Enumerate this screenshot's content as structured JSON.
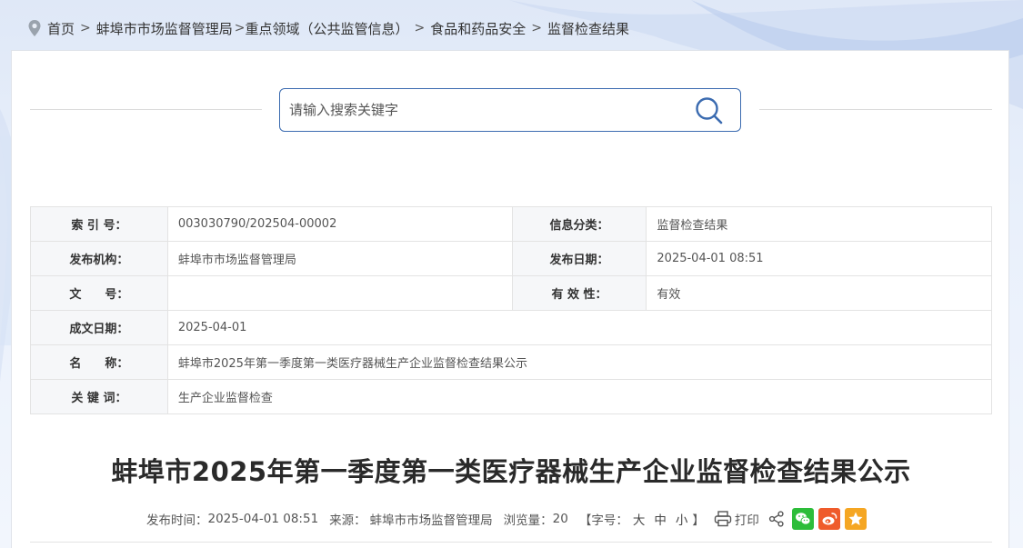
{
  "breadcrumb": {
    "home": "首页",
    "items": [
      "蚌埠市市场监督管理局",
      "重点领域（公共监管信息）",
      "食品和药品安全",
      "监督检查结果"
    ],
    "separator": ">"
  },
  "search": {
    "placeholder": "请输入搜索关键字"
  },
  "meta": {
    "index_label": "索 引 号：",
    "index_value": "003030790/202504-00002",
    "category_label": "信息分类：",
    "category_value": "监督检查结果",
    "publisher_label": "发布机构：",
    "publisher_value": "蚌埠市市场监督管理局",
    "pubdate_label": "发布日期：",
    "pubdate_value": "2025-04-01 08:51",
    "docno_label": "文　　号：",
    "docno_value": "",
    "validity_label": "有 效 性：",
    "validity_value": "有效",
    "written_label": "成文日期：",
    "written_value": "2025-04-01",
    "name_label": "名　　称：",
    "name_value": "蚌埠市2025年第一季度第一类医疗器械生产企业监督检查结果公示",
    "keywords_label": "关 键 词：",
    "keywords_value": "生产企业监督检查"
  },
  "article": {
    "title": "蚌埠市2025年第一季度第一类医疗器械生产企业监督检查结果公示"
  },
  "info": {
    "time_label": "发布时间：",
    "time_value": "2025-04-01 08:51",
    "source_label": "来源：",
    "source_value": "蚌埠市市场监督管理局",
    "views_label": "浏览量：",
    "views_value": "20",
    "fontsize_prefix": "【字号：",
    "size_large": "大",
    "size_medium": "中",
    "size_small": "小",
    "fontsize_suffix": "】",
    "print_label": "打印"
  },
  "colors": {
    "accent": "#3b6bb0",
    "wechat": "#2dbd3a",
    "weibo": "#ef5b2b",
    "favorite": "#f5a623"
  }
}
